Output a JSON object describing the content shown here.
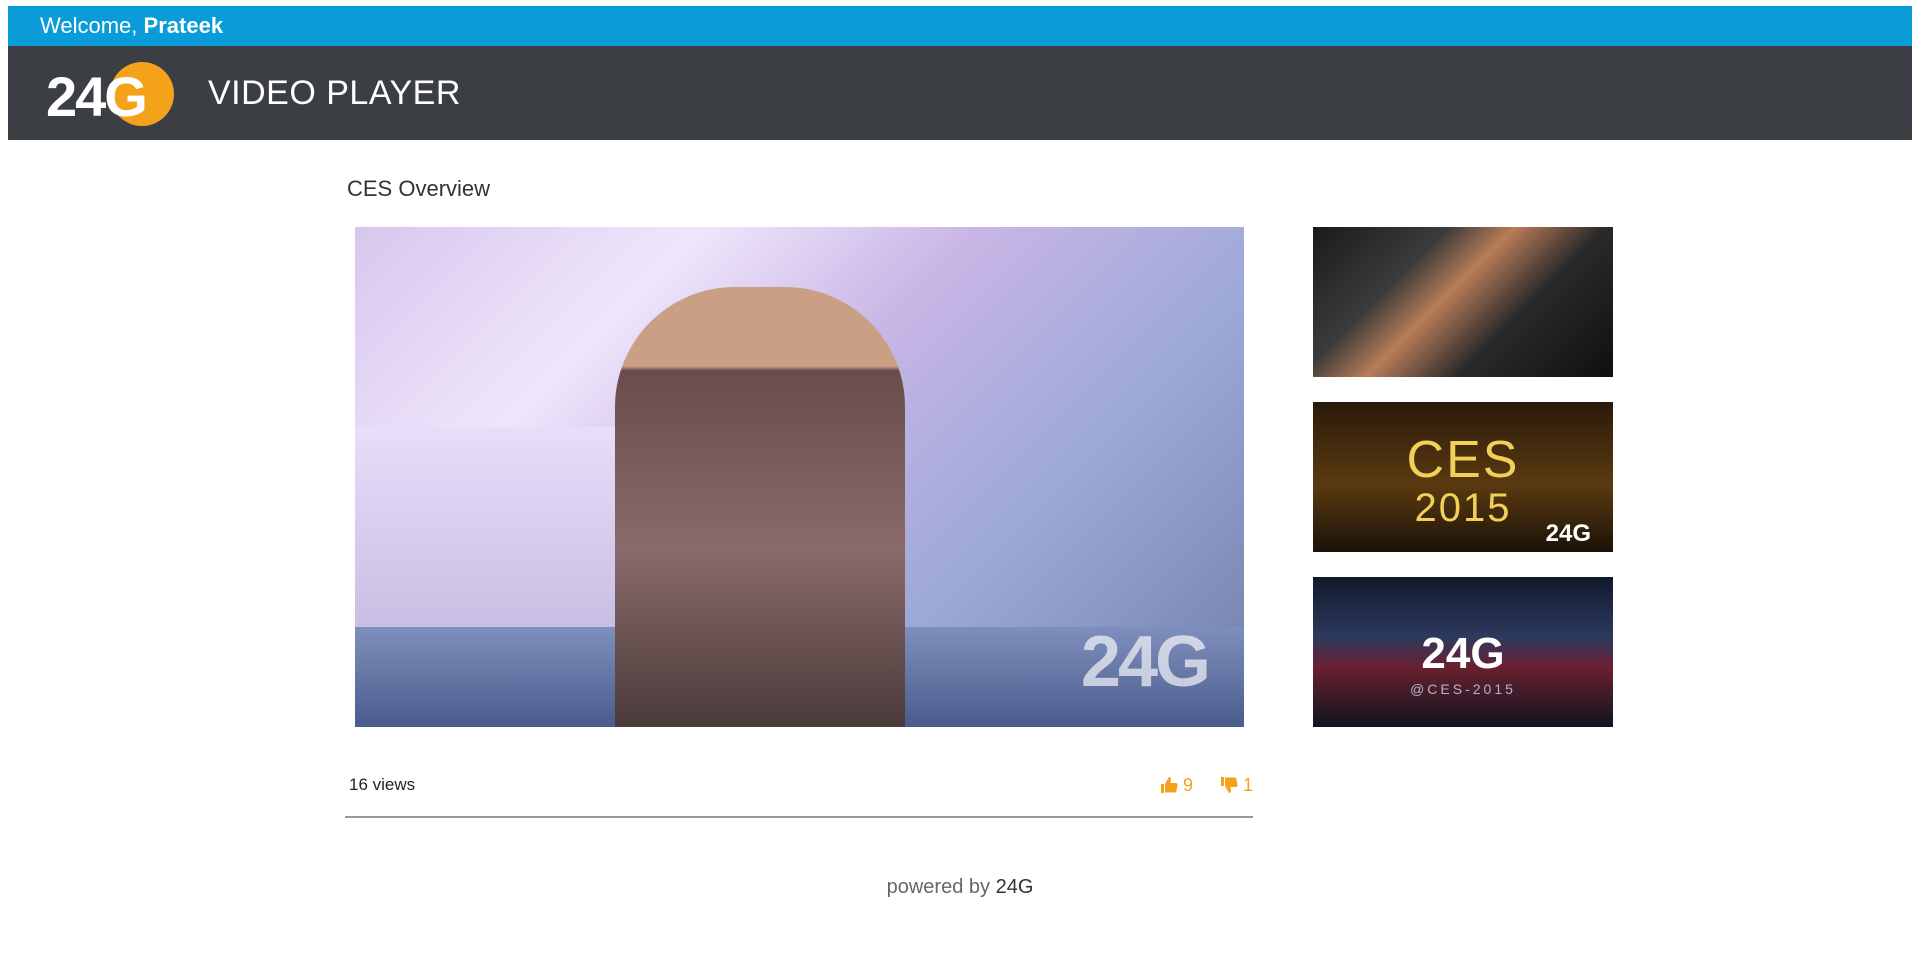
{
  "topbar": {
    "welcome": "Welcome",
    "separator": ",",
    "username": "Prateek"
  },
  "header": {
    "logo_text": "24G",
    "title": "VIDEO PLAYER"
  },
  "main": {
    "video_title": "CES Overview",
    "watermark": "24G",
    "views": "16 views",
    "likes": "9",
    "dislikes": "1"
  },
  "related": [
    {
      "text": ""
    },
    {
      "text": "CES",
      "sub": "2015",
      "badge": "24G"
    },
    {
      "logo": "24G",
      "tag": "@CES-2015"
    }
  ],
  "footer": {
    "prefix": "powered by",
    "brand": "24G"
  },
  "colors": {
    "accent": "#0a9cd9",
    "header": "#3b3e42",
    "brand_orange": "#f5a21b"
  }
}
